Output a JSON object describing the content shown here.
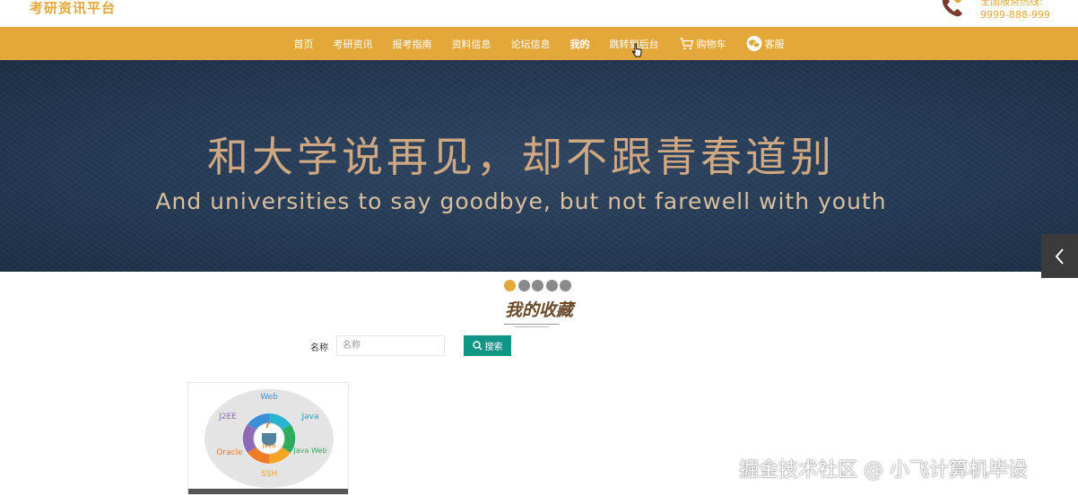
{
  "header": {
    "site_title": "考研资讯平台",
    "hotline_label": "全国服务热线:",
    "hotline_number": "9999-888-999"
  },
  "nav": {
    "items": [
      {
        "label": "首页",
        "icon": ""
      },
      {
        "label": "考研资讯",
        "icon": ""
      },
      {
        "label": "报考指南",
        "icon": ""
      },
      {
        "label": "资料信息",
        "icon": ""
      },
      {
        "label": "论坛信息",
        "icon": ""
      },
      {
        "label": "我的",
        "icon": ""
      },
      {
        "label": "跳转到后台",
        "icon": ""
      },
      {
        "label": "购物车",
        "icon": "cart-icon"
      },
      {
        "label": "客服",
        "icon": "chat-icon"
      }
    ]
  },
  "banner": {
    "title_cn": "和大学说再见，却不跟青春道别",
    "title_en": "And universities to say goodbye, but not farewell with youth",
    "dots": 5,
    "active_dot": 0
  },
  "section": {
    "title": "我的收藏"
  },
  "search": {
    "label": "名称",
    "placeholder": "名称",
    "button_label": "搜索"
  },
  "card": {
    "center_label": "java",
    "segments": [
      "Web",
      "Java",
      "Java Web",
      "SSH",
      "Oracle",
      "J2EE"
    ]
  },
  "watermark": "掘金技术社区 @ 小飞计算机毕设",
  "colors": {
    "accent": "#e3a73a",
    "button": "#119586",
    "banner_bg": "#253a55"
  }
}
